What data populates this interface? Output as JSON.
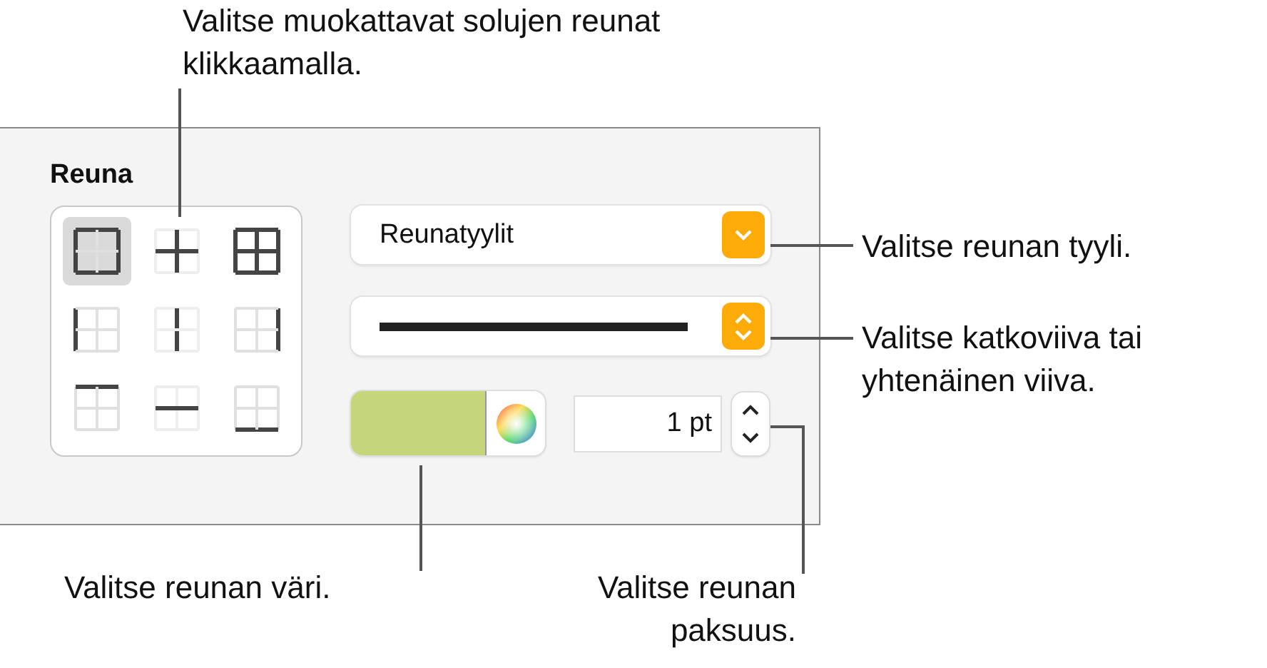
{
  "callouts": [
    {
      "text": "Valitse muokattavat solujen reunat klikkaamalla.",
      "kind": "top"
    },
    {
      "text": "Valitse reunan tyyli.",
      "kind": "right1"
    },
    {
      "text": "Valitse katkoviiva tai yhtenäinen viiva.",
      "kind": "right2"
    },
    {
      "text": "Valitse reunan väri.",
      "kind": "bottomleft"
    },
    {
      "text": "Valitse reunan paksuus.",
      "kind": "bottomright"
    }
  ],
  "panel": {
    "heading": "Reuna",
    "border_buttons": [
      {
        "kind": "outer",
        "selected": true
      },
      {
        "kind": "inner",
        "selected": false
      },
      {
        "kind": "all",
        "selected": false
      },
      {
        "kind": "left",
        "selected": false
      },
      {
        "kind": "inner_vertical",
        "selected": false
      },
      {
        "kind": "right",
        "selected": false
      },
      {
        "kind": "top",
        "selected": false
      },
      {
        "kind": "inner_horizontal",
        "selected": false
      },
      {
        "kind": "bottom",
        "selected": false
      }
    ],
    "style_menu": {
      "value": "Reunatyylit"
    },
    "color_well": {
      "color": "#c5d57a"
    },
    "width_field": {
      "value": "1 pt"
    }
  }
}
